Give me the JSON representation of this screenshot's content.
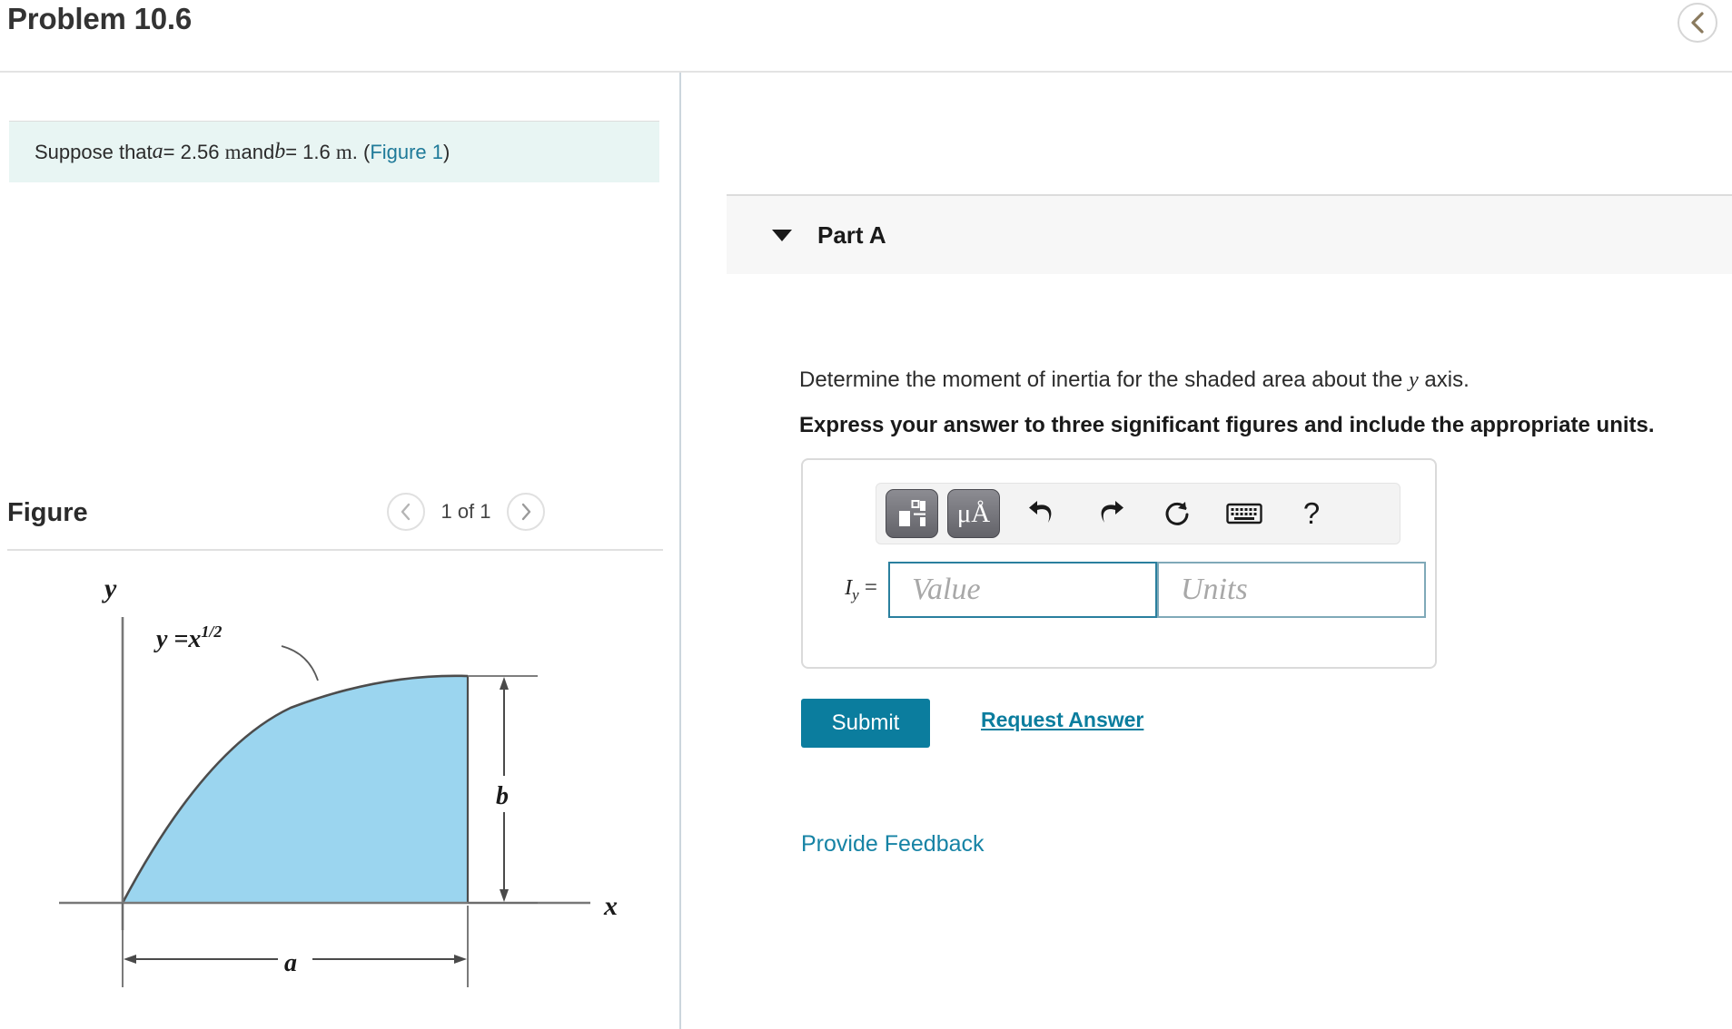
{
  "header": {
    "title": "Problem 10.6",
    "back_icon": "chevron-left-icon"
  },
  "left": {
    "statement": {
      "prefix": "Suppose that ",
      "var_a": "a",
      "a_eq": " = 2.56",
      "a_unit": "m",
      "mid": " and ",
      "var_b": "b",
      "b_eq": " = 1.6",
      "b_unit": "m",
      "period": " . (",
      "figure_link": "Figure 1",
      "closeparen": ")"
    },
    "figure": {
      "title": "Figure",
      "prev_icon": "chevron-left-icon",
      "next_icon": "chevron-right-icon",
      "pager_label": "1 of 1",
      "diagram": {
        "y_axis_label": "y",
        "x_axis_label": "x",
        "curve_label": "y = x",
        "curve_exponent": "1/2",
        "height_label": "b",
        "width_label": "a",
        "fill_color": "#9BD5EF",
        "stroke_color": "#4c4c4c"
      }
    }
  },
  "right": {
    "part": {
      "caret_icon": "caret-down-icon",
      "label": "Part A"
    },
    "question_prefix": "Determine the moment of inertia for the shaded area about the ",
    "question_var": "y",
    "question_suffix": " axis.",
    "express": "Express your answer to three significant figures and include the appropriate units.",
    "toolbar": {
      "buttons": [
        {
          "name": "template-icon",
          "label": ""
        },
        {
          "name": "units-mu-angstrom-icon",
          "label": "μÅ"
        },
        {
          "name": "undo-icon",
          "label": ""
        },
        {
          "name": "redo-icon",
          "label": ""
        },
        {
          "name": "reset-icon",
          "label": ""
        },
        {
          "name": "keyboard-icon",
          "label": ""
        },
        {
          "name": "help-icon",
          "label": "?"
        }
      ]
    },
    "answer": {
      "symbol": "I",
      "symbol_sub": "y",
      "equals": " =",
      "value_placeholder": "Value",
      "units_placeholder": "Units"
    },
    "submit_label": "Submit",
    "request_answer_label": "Request Answer",
    "provide_feedback_label": "Provide Feedback"
  },
  "colors": {
    "accent_teal": "#0b7d9e",
    "link_blue": "#1683a5",
    "statement_bg": "#e8f5f3",
    "part_header_bg": "#f7f7f7"
  }
}
